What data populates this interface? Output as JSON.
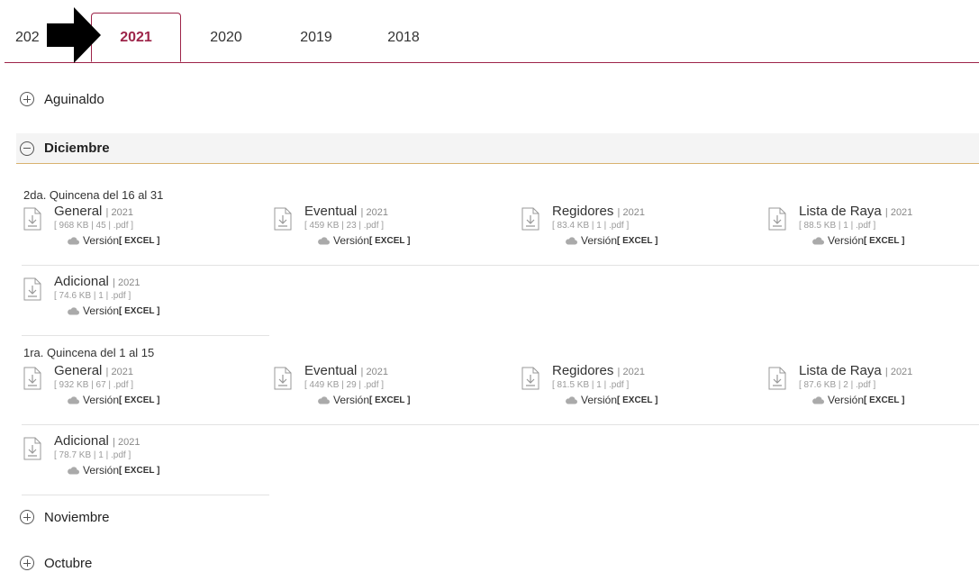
{
  "tabs": [
    "202",
    "2021",
    "2020",
    "2019",
    "2018"
  ],
  "active_tab": "2021",
  "accordion": {
    "aguinaldo": "Aguinaldo",
    "diciembre": "Diciembre",
    "noviembre": "Noviembre",
    "octubre": "Octubre"
  },
  "sections": [
    {
      "title": "2da. Quincena del 16 al 31",
      "docs": [
        {
          "name": "General",
          "year": "| 2021",
          "meta": "[ 968 KB | 45 | .pdf ]"
        },
        {
          "name": "Eventual",
          "year": "| 2021",
          "meta": "[ 459 KB | 23 | .pdf ]"
        },
        {
          "name": "Regidores",
          "year": "| 2021",
          "meta": "[ 83.4 KB | 1 | .pdf ]"
        },
        {
          "name": "Lista de Raya",
          "year": "| 2021",
          "meta": "[ 88.5 KB | 1 | .pdf ]"
        },
        {
          "name": "Adicional",
          "year": "| 2021",
          "meta": "[ 74.6 KB | 1 | .pdf ]"
        }
      ]
    },
    {
      "title": "1ra. Quincena del 1 al 15",
      "docs": [
        {
          "name": "General",
          "year": "| 2021",
          "meta": "[ 932 KB | 67 | .pdf ]"
        },
        {
          "name": "Eventual",
          "year": "| 2021",
          "meta": "[ 449 KB | 29 | .pdf ]"
        },
        {
          "name": "Regidores",
          "year": "| 2021",
          "meta": "[ 81.5 KB | 1 | .pdf ]"
        },
        {
          "name": "Lista de Raya",
          "year": "| 2021",
          "meta": "[ 87.6 KB | 2 | .pdf ]"
        },
        {
          "name": "Adicional",
          "year": "| 2021",
          "meta": "[ 78.7 KB | 1 | .pdf ]"
        }
      ]
    }
  ],
  "excel": {
    "version_label": "Versión",
    "excel_label": "[ EXCEL ]"
  },
  "colors": {
    "accent": "#9d2449",
    "divider": "#d9b26f"
  }
}
